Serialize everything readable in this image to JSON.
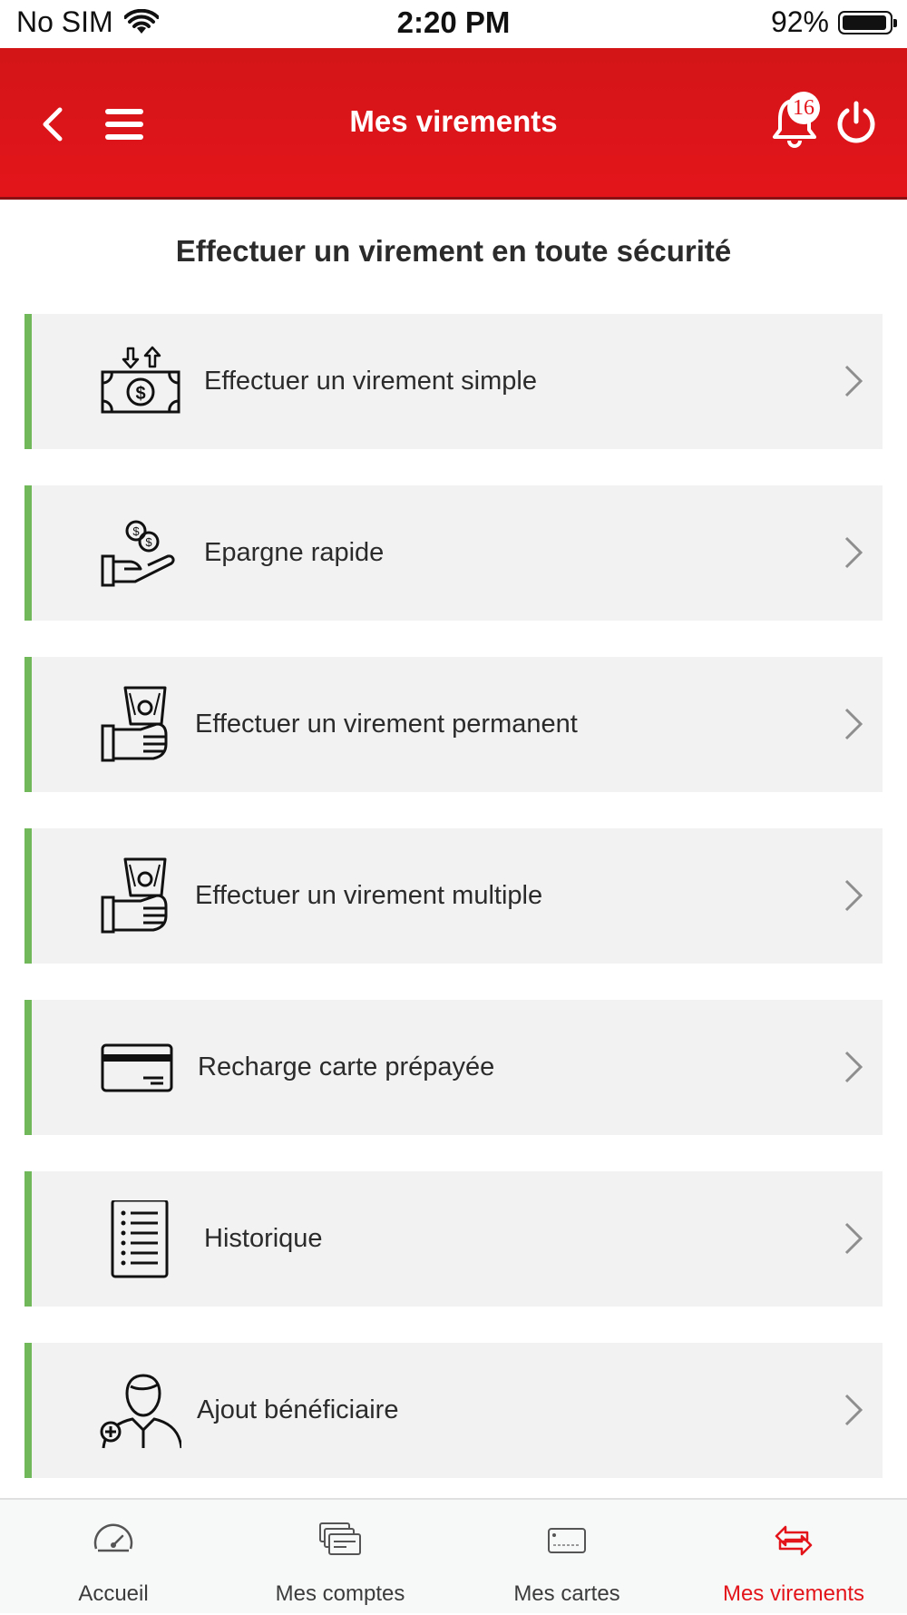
{
  "status_bar": {
    "carrier": "No SIM",
    "time": "2:20 PM",
    "battery": "92%"
  },
  "header": {
    "title": "Mes virements",
    "notification_count": "16",
    "background_color": "#e3151b"
  },
  "subtitle": "Effectuer un virement en toute sécurité",
  "accent_color": "#71b85a",
  "menu_items": [
    {
      "label": "Effectuer un virement simple",
      "icon": "money-transfer-icon"
    },
    {
      "label": "Epargne rapide",
      "icon": "coins-hand-icon"
    },
    {
      "label": "Effectuer un virement permanent",
      "icon": "cash-hand-icon"
    },
    {
      "label": "Effectuer un virement multiple",
      "icon": "cash-hand-icon"
    },
    {
      "label": "Recharge carte prépayée",
      "icon": "credit-card-icon"
    },
    {
      "label": "Historique",
      "icon": "history-list-icon"
    },
    {
      "label": "Ajout bénéficiaire",
      "icon": "add-beneficiary-icon"
    }
  ],
  "tabs": [
    {
      "label": "Accueil",
      "icon": "dashboard-gauge-icon",
      "active": false
    },
    {
      "label": "Mes comptes",
      "icon": "accounts-icon",
      "active": false
    },
    {
      "label": "Mes cartes",
      "icon": "card-icon",
      "active": false
    },
    {
      "label": "Mes virements",
      "icon": "transfer-arrows-icon",
      "active": true
    }
  ]
}
